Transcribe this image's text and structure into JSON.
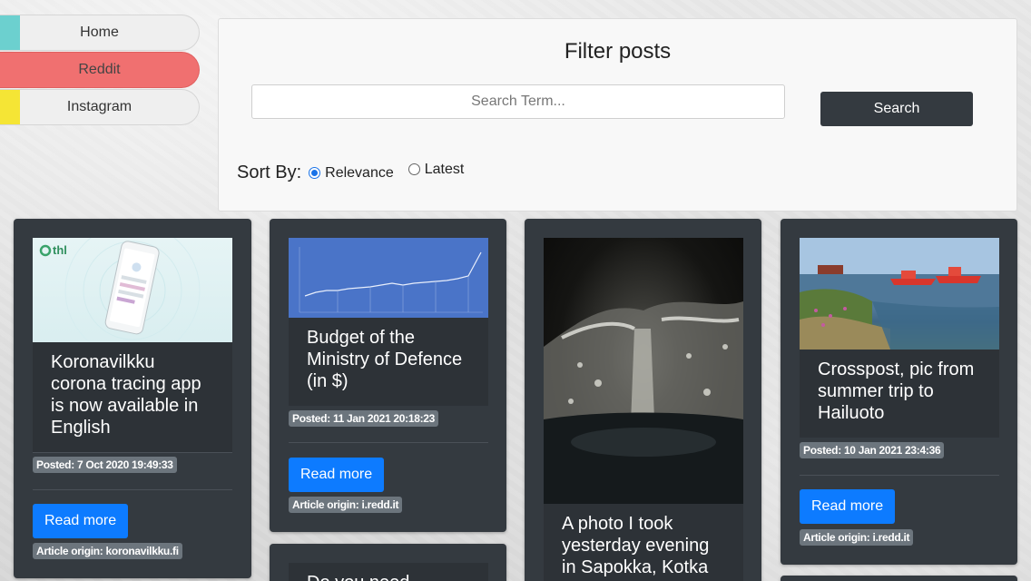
{
  "nav": {
    "items": [
      {
        "label": "Home",
        "stripe": "#6cd0cf",
        "active": false
      },
      {
        "label": "Reddit",
        "stripe": "#f07070",
        "active": true
      },
      {
        "label": "Instagram",
        "stripe": "#f5e535",
        "active": false
      }
    ]
  },
  "filter": {
    "title": "Filter posts",
    "search_placeholder": "Search Term...",
    "search_value": "",
    "search_button": "Search",
    "sort_label": "Sort By:",
    "sort_options": [
      {
        "label": "Relevance",
        "selected": true
      },
      {
        "label": "Latest",
        "selected": false
      }
    ]
  },
  "cards": [
    {
      "title": "Koronavilkku corona tracing app is now available in English",
      "posted": "Posted: 7 Oct 2020 19:49:33",
      "button": "Read more",
      "origin": "Article origin: koronavilkku.fi",
      "image_logo": "thl"
    },
    {
      "title": "Budget of the Ministry of Defence (in $)",
      "posted": "Posted: 11 Jan 2021 20:18:23",
      "button": "Read more",
      "origin": "Article origin: i.redd.it"
    },
    {
      "title": "A photo I took yesterday evening in Sapokka, Kotka"
    },
    {
      "title": "Crosspost, pic from summer trip to Hailuoto",
      "posted": "Posted: 10 Jan 2021 23:4:36",
      "button": "Read more",
      "origin": "Article origin: i.redd.it"
    },
    {
      "title": "Do you need"
    }
  ],
  "colors": {
    "card_bg": "#343a40",
    "button_blue": "#0d7bff",
    "search_button": "#343a40",
    "badge": "#6c757d"
  }
}
